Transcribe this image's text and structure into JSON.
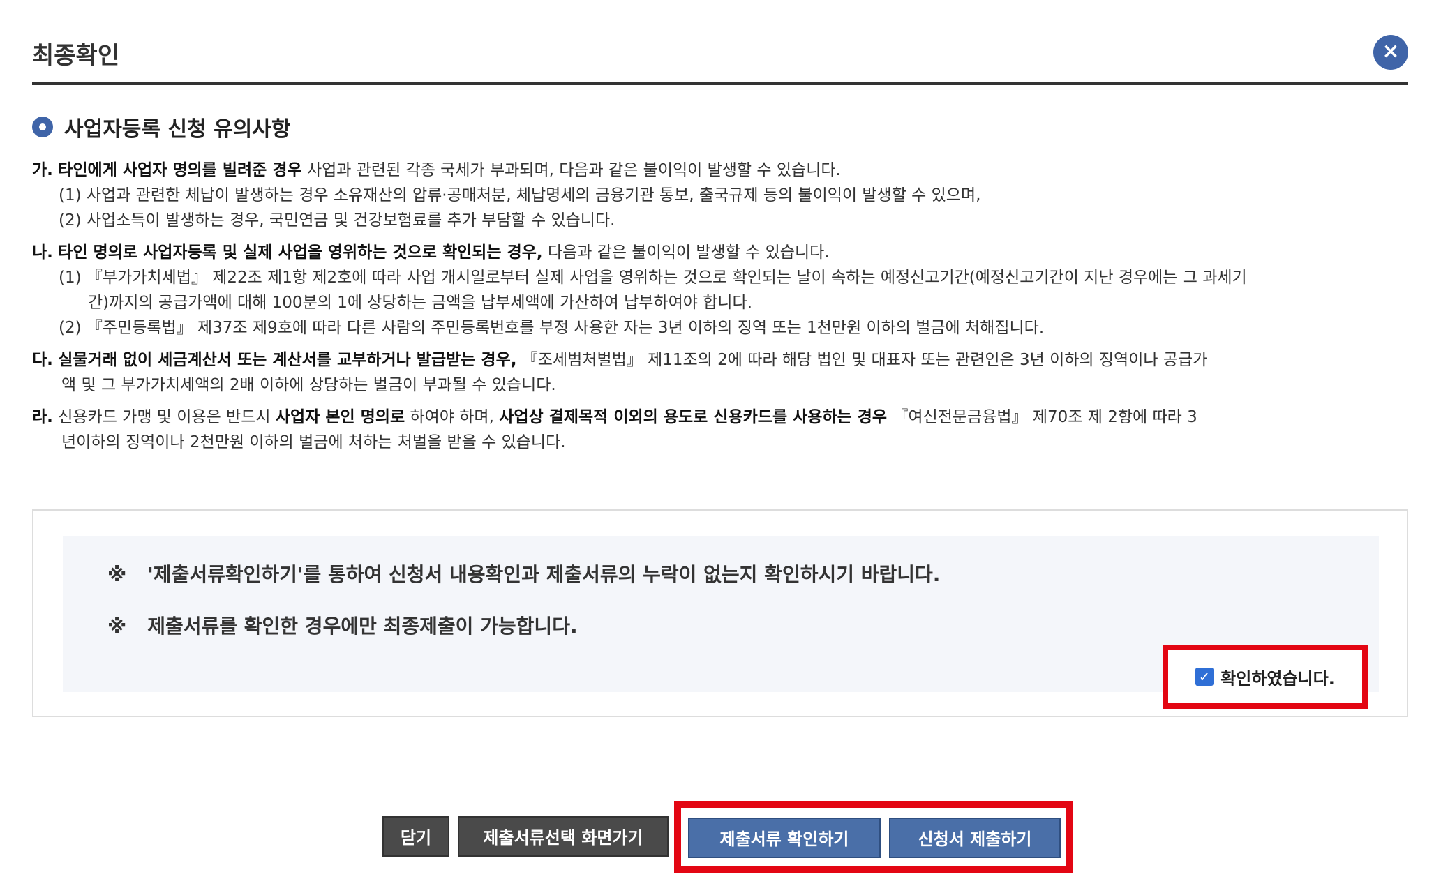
{
  "dialog": {
    "title": "최종확인",
    "close_icon": "×"
  },
  "section": {
    "heading": "사업자등록 신청 유의사항"
  },
  "notices": {
    "ga": {
      "prefix": "가.",
      "bold": "타인에게 사업자 명의를 빌려준 경우",
      "text": " 사업과 관련된 각종 국세가 부과되며, 다음과 같은 불이익이 발생할 수 있습니다.",
      "sub1": "(1) 사업과 관련한 체납이 발생하는 경우 소유재산의 압류·공매처분, 체납명세의 금융기관 통보, 출국규제 등의 불이익이 발생할 수 있으며,",
      "sub2": "(2) 사업소득이 발생하는 경우, 국민연금 및 건강보험료를 추가 부담할 수 있습니다."
    },
    "na": {
      "prefix": "나.",
      "bold": "타인 명의로 사업자등록 및 실제 사업을 영위하는 것으로 확인되는 경우,",
      "text": " 다음과 같은 불이익이 발생할 수 있습니다.",
      "sub1": "(1) 『부가가치세법』 제22조 제1항 제2호에 따라 사업 개시일로부터 실제 사업을 영위하는 것으로 확인되는 날이 속하는 예정신고기간(예정신고기간이 지난 경우에는 그 과세기",
      "sub1_cont": "간)까지의 공급가액에 대해 100분의 1에 상당하는 금액을 납부세액에 가산하여 납부하여야 합니다.",
      "sub2": "(2) 『주민등록법』 제37조 제9호에 따라 다른 사람의 주민등록번호를 부정 사용한 자는 3년 이하의 징역 또는 1천만원 이하의 벌금에 처해집니다."
    },
    "da": {
      "prefix": "다.",
      "bold": "실물거래 없이 세금계산서 또는 계산서를 교부하거나 발급받는 경우,",
      "text": " 『조세범처벌법』 제11조의 2에 따라 해당 법인 및 대표자 또는 관련인은 3년 이하의 징역이나 공급가",
      "cont": "액 및 그 부가가치세액의 2배 이하에 상당하는 벌금이 부과될 수 있습니다."
    },
    "ra": {
      "prefix": "라.",
      "text1": " 신용카드 가맹 및 이용은 반드시 ",
      "bold1": "사업자 본인 명의로",
      "text2": " 하여야 하며, ",
      "bold2": "사업상 결제목적 이외의 용도로 신용카드를 사용하는 경우",
      "text3": " 『여신전문금융법』 제70조 제 2항에 따라 3",
      "cont": "년이하의 징역이나 2천만원 이하의 벌금에 처하는 처벌을 받을 수 있습니다."
    }
  },
  "confirm": {
    "mark": "※",
    "line1": "'제출서류확인하기'를 통하여 신청서 내용확인과 제출서류의 누락이 없는지 확인하시기 바랍니다.",
    "line2": "제출서류를 확인한 경우에만 최종제출이 가능합니다.",
    "checkbox_label": "확인하였습니다.",
    "checked": true
  },
  "buttons": {
    "close": "닫기",
    "go_select": "제출서류선택 화면가기",
    "check_docs": "제출서류 확인하기",
    "submit": "신청서 제출하기"
  },
  "colors": {
    "accent": "#3f64a8",
    "highlight": "#e30613",
    "dark_button": "#4a4a4a",
    "blue_button": "#4a6fa8"
  }
}
